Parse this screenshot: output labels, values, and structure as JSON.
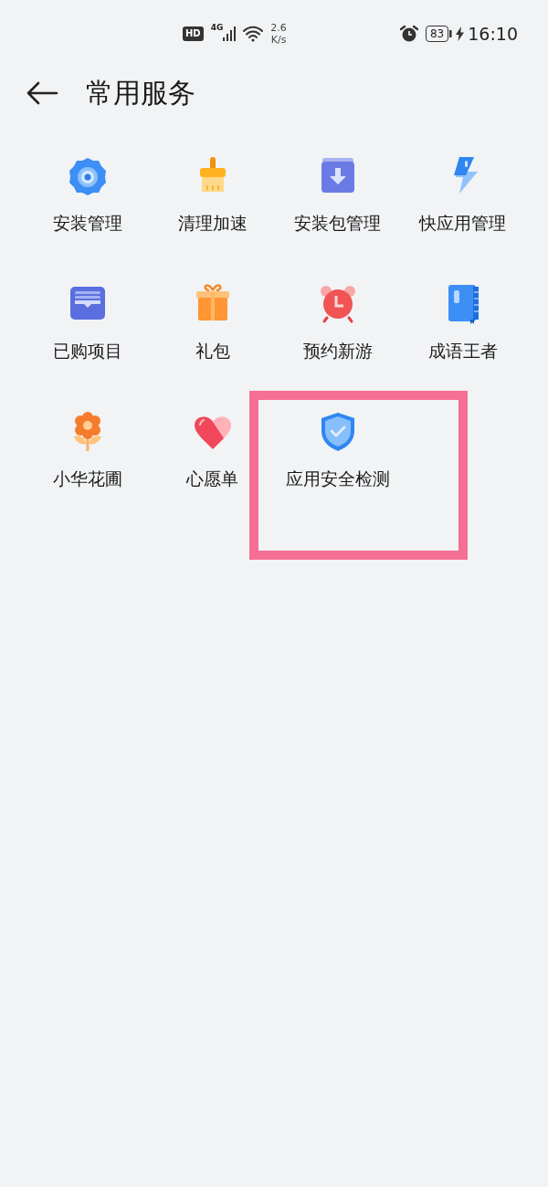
{
  "status_bar": {
    "hd": "HD",
    "network": "4G",
    "speed_value": "2.6",
    "speed_unit": "K/s",
    "battery": "83",
    "charging": true,
    "time": "16:10"
  },
  "header": {
    "title": "常用服务"
  },
  "services": [
    {
      "kind": "gear",
      "label": "安装管理",
      "highlighted": false
    },
    {
      "kind": "broom",
      "label": "清理加速",
      "highlighted": false
    },
    {
      "kind": "package",
      "label": "安装包管理",
      "highlighted": false
    },
    {
      "kind": "bolt",
      "label": "快应用管理",
      "highlighted": false
    },
    {
      "kind": "tray",
      "label": "已购项目",
      "highlighted": false
    },
    {
      "kind": "gift",
      "label": "礼包",
      "highlighted": false
    },
    {
      "kind": "alarm",
      "label": "预约新游",
      "highlighted": false
    },
    {
      "kind": "book",
      "label": "成语王者",
      "highlighted": false
    },
    {
      "kind": "flower",
      "label": "小华花圃",
      "highlighted": false
    },
    {
      "kind": "heart",
      "label": "心愿单",
      "highlighted": false
    },
    {
      "kind": "shield",
      "label": "应用安全检测",
      "highlighted": true
    }
  ]
}
